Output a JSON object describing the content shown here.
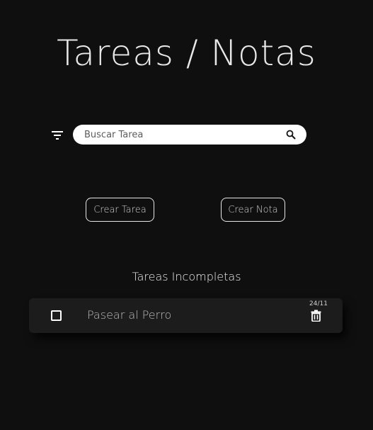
{
  "header": {
    "title": "Tareas / Notas"
  },
  "toolbar": {
    "filter_icon": "filter-icon",
    "search": {
      "placeholder": "Buscar Tarea",
      "value": "",
      "icon": "search-icon"
    }
  },
  "actions": {
    "create_task_label": "Crear Tarea",
    "create_note_label": "Crear Nota"
  },
  "tasks": {
    "section_title": "Tareas Incompletas",
    "items": [
      {
        "text": "Pasear al Perro",
        "date": "24/11",
        "done": false,
        "delete_icon": "trash-icon"
      }
    ]
  },
  "colors": {
    "background": "#0f0f0f",
    "card": "#1c1c1c",
    "text": "#ffffff"
  }
}
